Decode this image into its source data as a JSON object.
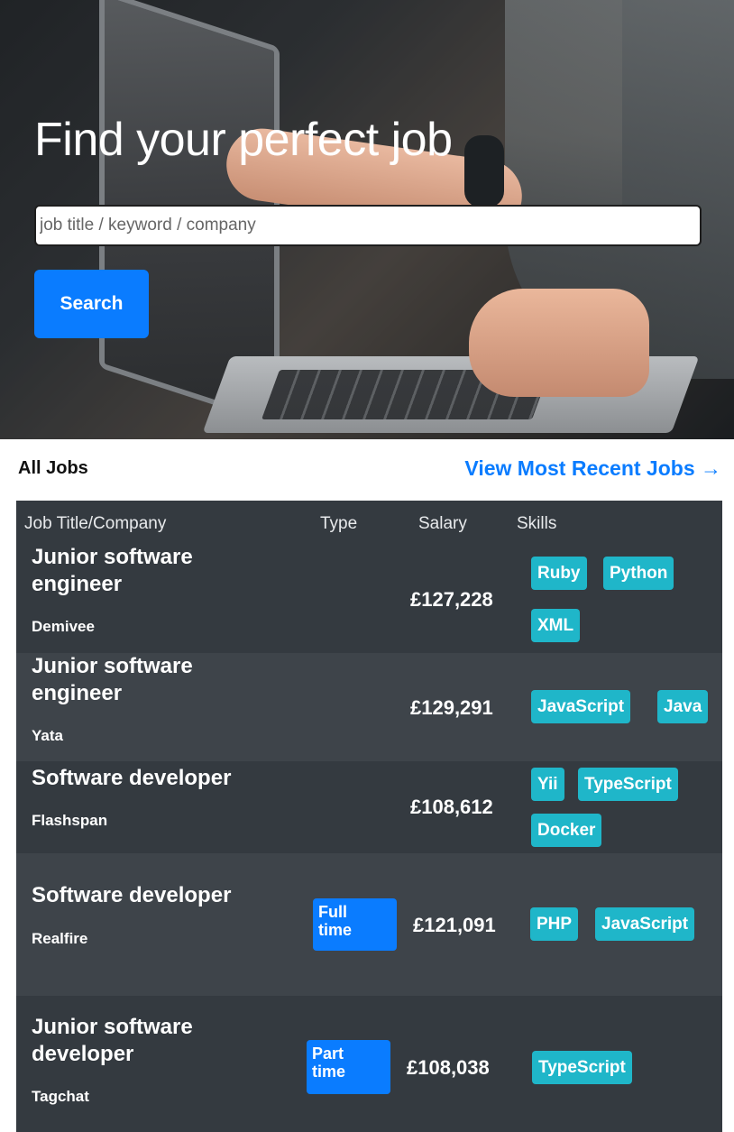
{
  "hero": {
    "title": "Find your perfect job",
    "search_placeholder": "job title / keyword / company",
    "search_button": "Search"
  },
  "jobs_section": {
    "heading": "All Jobs",
    "recent_link": "View Most Recent Jobs →"
  },
  "table": {
    "headers": [
      "Job Title/Company",
      "Type",
      "Salary",
      "Skills"
    ],
    "rows": [
      {
        "title": "Junior software engineer",
        "title_lines": [
          "Junior software",
          "engineer"
        ],
        "company": "Demivee",
        "type": "",
        "salary": "£127,228",
        "skills": [
          "Ruby",
          "Python",
          "XML"
        ]
      },
      {
        "title": "Junior software engineer",
        "title_lines": [
          "Junior software",
          "engineer"
        ],
        "company": "Yata",
        "type": "",
        "salary": "£129,291",
        "skills": [
          "JavaScript",
          "Java"
        ]
      },
      {
        "title": "Software developer",
        "title_lines": [
          "Software developer"
        ],
        "company": "Flashspan",
        "type": "",
        "salary": "£108,612",
        "skills": [
          "Yii",
          "TypeScript",
          "Docker"
        ]
      },
      {
        "title": "Software developer",
        "title_lines": [
          "Software developer"
        ],
        "company": "Realfire",
        "type": "Full time",
        "type_lines": [
          "Full",
          "time"
        ],
        "salary": "£121,091",
        "skills": [
          "PHP",
          "JavaScript"
        ]
      },
      {
        "title": "Junior software developer",
        "title_lines": [
          "Junior software",
          "developer"
        ],
        "company": "Tagchat",
        "type": "Part time",
        "type_lines": [
          "Part",
          "time"
        ],
        "salary": "£108,038",
        "skills": [
          "TypeScript"
        ]
      }
    ]
  }
}
